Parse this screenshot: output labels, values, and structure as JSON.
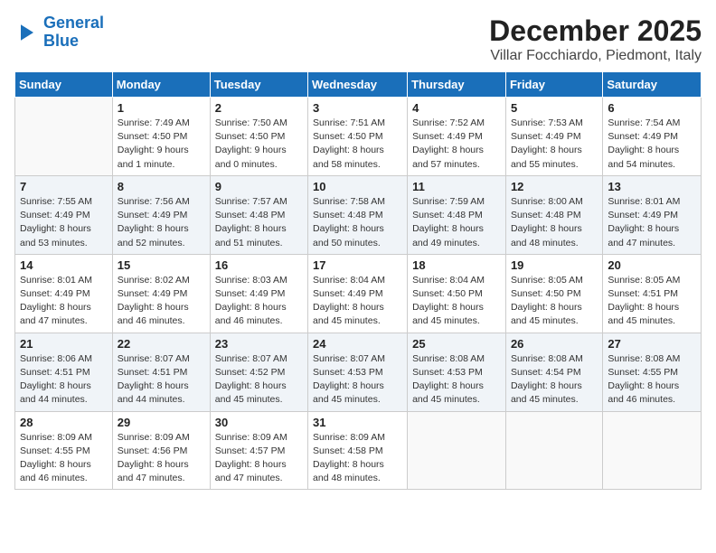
{
  "header": {
    "logo_line1": "General",
    "logo_line2": "Blue",
    "title": "December 2025",
    "subtitle": "Villar Focchiardo, Piedmont, Italy"
  },
  "days_of_week": [
    "Sunday",
    "Monday",
    "Tuesday",
    "Wednesday",
    "Thursday",
    "Friday",
    "Saturday"
  ],
  "weeks": [
    [
      {
        "day": "",
        "info": ""
      },
      {
        "day": "1",
        "info": "Sunrise: 7:49 AM\nSunset: 4:50 PM\nDaylight: 9 hours\nand 1 minute."
      },
      {
        "day": "2",
        "info": "Sunrise: 7:50 AM\nSunset: 4:50 PM\nDaylight: 9 hours\nand 0 minutes."
      },
      {
        "day": "3",
        "info": "Sunrise: 7:51 AM\nSunset: 4:50 PM\nDaylight: 8 hours\nand 58 minutes."
      },
      {
        "day": "4",
        "info": "Sunrise: 7:52 AM\nSunset: 4:49 PM\nDaylight: 8 hours\nand 57 minutes."
      },
      {
        "day": "5",
        "info": "Sunrise: 7:53 AM\nSunset: 4:49 PM\nDaylight: 8 hours\nand 55 minutes."
      },
      {
        "day": "6",
        "info": "Sunrise: 7:54 AM\nSunset: 4:49 PM\nDaylight: 8 hours\nand 54 minutes."
      }
    ],
    [
      {
        "day": "7",
        "info": "Sunrise: 7:55 AM\nSunset: 4:49 PM\nDaylight: 8 hours\nand 53 minutes."
      },
      {
        "day": "8",
        "info": "Sunrise: 7:56 AM\nSunset: 4:49 PM\nDaylight: 8 hours\nand 52 minutes."
      },
      {
        "day": "9",
        "info": "Sunrise: 7:57 AM\nSunset: 4:48 PM\nDaylight: 8 hours\nand 51 minutes."
      },
      {
        "day": "10",
        "info": "Sunrise: 7:58 AM\nSunset: 4:48 PM\nDaylight: 8 hours\nand 50 minutes."
      },
      {
        "day": "11",
        "info": "Sunrise: 7:59 AM\nSunset: 4:48 PM\nDaylight: 8 hours\nand 49 minutes."
      },
      {
        "day": "12",
        "info": "Sunrise: 8:00 AM\nSunset: 4:48 PM\nDaylight: 8 hours\nand 48 minutes."
      },
      {
        "day": "13",
        "info": "Sunrise: 8:01 AM\nSunset: 4:49 PM\nDaylight: 8 hours\nand 47 minutes."
      }
    ],
    [
      {
        "day": "14",
        "info": "Sunrise: 8:01 AM\nSunset: 4:49 PM\nDaylight: 8 hours\nand 47 minutes."
      },
      {
        "day": "15",
        "info": "Sunrise: 8:02 AM\nSunset: 4:49 PM\nDaylight: 8 hours\nand 46 minutes."
      },
      {
        "day": "16",
        "info": "Sunrise: 8:03 AM\nSunset: 4:49 PM\nDaylight: 8 hours\nand 46 minutes."
      },
      {
        "day": "17",
        "info": "Sunrise: 8:04 AM\nSunset: 4:49 PM\nDaylight: 8 hours\nand 45 minutes."
      },
      {
        "day": "18",
        "info": "Sunrise: 8:04 AM\nSunset: 4:50 PM\nDaylight: 8 hours\nand 45 minutes."
      },
      {
        "day": "19",
        "info": "Sunrise: 8:05 AM\nSunset: 4:50 PM\nDaylight: 8 hours\nand 45 minutes."
      },
      {
        "day": "20",
        "info": "Sunrise: 8:05 AM\nSunset: 4:51 PM\nDaylight: 8 hours\nand 45 minutes."
      }
    ],
    [
      {
        "day": "21",
        "info": "Sunrise: 8:06 AM\nSunset: 4:51 PM\nDaylight: 8 hours\nand 44 minutes."
      },
      {
        "day": "22",
        "info": "Sunrise: 8:07 AM\nSunset: 4:51 PM\nDaylight: 8 hours\nand 44 minutes."
      },
      {
        "day": "23",
        "info": "Sunrise: 8:07 AM\nSunset: 4:52 PM\nDaylight: 8 hours\nand 45 minutes."
      },
      {
        "day": "24",
        "info": "Sunrise: 8:07 AM\nSunset: 4:53 PM\nDaylight: 8 hours\nand 45 minutes."
      },
      {
        "day": "25",
        "info": "Sunrise: 8:08 AM\nSunset: 4:53 PM\nDaylight: 8 hours\nand 45 minutes."
      },
      {
        "day": "26",
        "info": "Sunrise: 8:08 AM\nSunset: 4:54 PM\nDaylight: 8 hours\nand 45 minutes."
      },
      {
        "day": "27",
        "info": "Sunrise: 8:08 AM\nSunset: 4:55 PM\nDaylight: 8 hours\nand 46 minutes."
      }
    ],
    [
      {
        "day": "28",
        "info": "Sunrise: 8:09 AM\nSunset: 4:55 PM\nDaylight: 8 hours\nand 46 minutes."
      },
      {
        "day": "29",
        "info": "Sunrise: 8:09 AM\nSunset: 4:56 PM\nDaylight: 8 hours\nand 47 minutes."
      },
      {
        "day": "30",
        "info": "Sunrise: 8:09 AM\nSunset: 4:57 PM\nDaylight: 8 hours\nand 47 minutes."
      },
      {
        "day": "31",
        "info": "Sunrise: 8:09 AM\nSunset: 4:58 PM\nDaylight: 8 hours\nand 48 minutes."
      },
      {
        "day": "",
        "info": ""
      },
      {
        "day": "",
        "info": ""
      },
      {
        "day": "",
        "info": ""
      }
    ]
  ]
}
